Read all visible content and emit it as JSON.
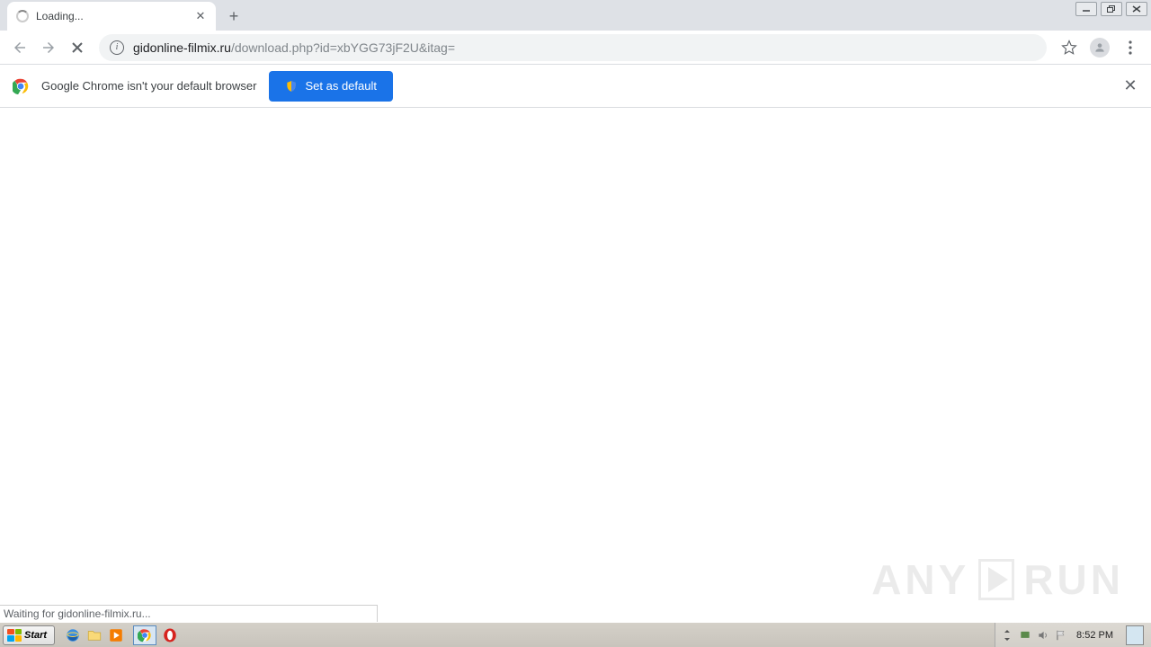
{
  "tab": {
    "title": "Loading..."
  },
  "url": {
    "domain": "gidonline-filmix.ru",
    "rest": "/download.php?id=xbYGG73jF2U&itag="
  },
  "infobar": {
    "message": "Google Chrome isn't your default browser",
    "button": "Set as default"
  },
  "status": {
    "text": "Waiting for gidonline-filmix.ru..."
  },
  "watermark": {
    "left": "ANY",
    "right": "RUN"
  },
  "taskbar": {
    "start": "Start",
    "clock": "8:52 PM"
  }
}
